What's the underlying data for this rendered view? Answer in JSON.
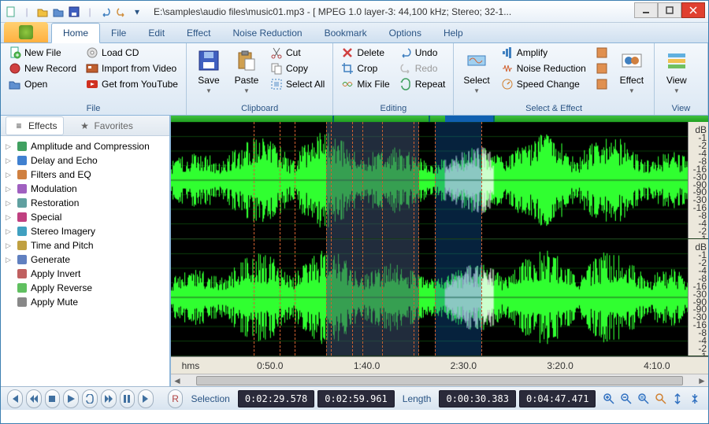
{
  "title": "E:\\samples\\audio files\\music01.mp3 - [ MPEG 1.0 layer-3: 44,100 kHz; Stereo; 32-1...",
  "ribbon_tabs": [
    "Home",
    "File",
    "Edit",
    "Effect",
    "Noise Reduction",
    "Bookmark",
    "Options",
    "Help"
  ],
  "active_tab": "Home",
  "groups": {
    "file": {
      "title": "File",
      "new_file": "New File",
      "new_record": "New Record",
      "open": "Open",
      "load_cd": "Load CD",
      "import_video": "Import from Video",
      "get_youtube": "Get from YouTube"
    },
    "clipboard": {
      "title": "Clipboard",
      "save": "Save",
      "paste": "Paste",
      "cut": "Cut",
      "copy": "Copy",
      "select_all": "Select All"
    },
    "editing": {
      "title": "Editing",
      "delete": "Delete",
      "crop": "Crop",
      "mix": "Mix File",
      "undo": "Undo",
      "redo": "Redo",
      "repeat": "Repeat"
    },
    "select_effect": {
      "title": "Select & Effect",
      "select": "Select",
      "amplify": "Amplify",
      "noise_red": "Noise Reduction",
      "speed": "Speed Change",
      "effect": "Effect"
    },
    "view": {
      "title": "View",
      "view": "View"
    }
  },
  "side_tabs": {
    "effects": "Effects",
    "favorites": "Favorites"
  },
  "effects_tree": [
    {
      "label": "Amplitude and Compression",
      "expandable": true,
      "icon": "amp"
    },
    {
      "label": "Delay and Echo",
      "expandable": true,
      "icon": "delay"
    },
    {
      "label": "Filters and EQ",
      "expandable": true,
      "icon": "eq"
    },
    {
      "label": "Modulation",
      "expandable": true,
      "icon": "mod"
    },
    {
      "label": "Restoration",
      "expandable": true,
      "icon": "rest"
    },
    {
      "label": "Special",
      "expandable": true,
      "icon": "spec"
    },
    {
      "label": "Stereo Imagery",
      "expandable": true,
      "icon": "stereo"
    },
    {
      "label": "Time and Pitch",
      "expandable": true,
      "icon": "time"
    },
    {
      "label": "Generate",
      "expandable": true,
      "icon": "gen"
    },
    {
      "label": "Apply Invert",
      "expandable": false,
      "icon": "inv"
    },
    {
      "label": "Apply Reverse",
      "expandable": false,
      "icon": "rev"
    },
    {
      "label": "Apply Mute",
      "expandable": false,
      "icon": "mute"
    }
  ],
  "db_labels": [
    "dB",
    "-1",
    "-2",
    "-4",
    "-8",
    "-16",
    "-30",
    "-90",
    "-90",
    "-30",
    "-16",
    "-8",
    "-4",
    "-2",
    "-1"
  ],
  "time_labels": [
    {
      "pos": "2%",
      "t": "hms"
    },
    {
      "pos": "16%",
      "t": "0:50.0"
    },
    {
      "pos": "34%",
      "t": "1:40.0"
    },
    {
      "pos": "52%",
      "t": "2:30.0"
    },
    {
      "pos": "70%",
      "t": "3:20.0"
    },
    {
      "pos": "88%",
      "t": "4:10.0"
    }
  ],
  "selection": {
    "start_pct": 30,
    "end_pct": 48
  },
  "playhead": {
    "start_pct": 51,
    "end_pct": 60
  },
  "guides_pct": [
    16,
    21,
    24,
    31,
    35,
    47,
    51,
    60
  ],
  "status": {
    "sel_label": "Selection",
    "sel_start": "0:02:29.578",
    "sel_end": "0:02:59.961",
    "len_label": "Length",
    "len_val": "0:00:30.383",
    "total": "0:04:47.471",
    "rec": "R"
  },
  "colors": {
    "wave": "#30ff30",
    "wave_play": "#ffffff",
    "accent": "#1060b0"
  }
}
